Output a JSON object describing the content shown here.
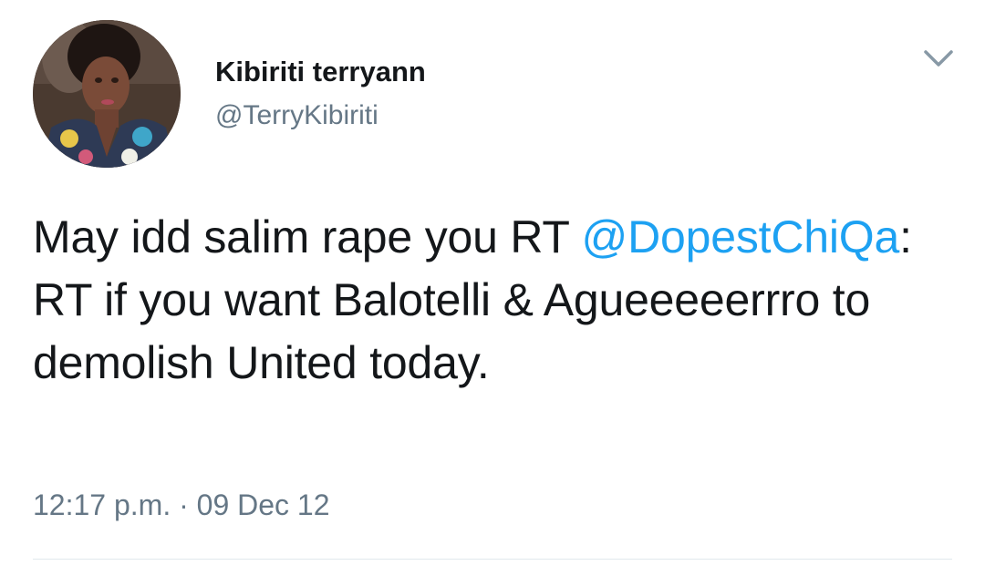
{
  "tweet": {
    "author": {
      "display_name": "Kibiriti terryann",
      "handle": "@TerryKibiriti",
      "avatar_icon": "profile-photo"
    },
    "menu_icon": "chevron-down-icon",
    "text": {
      "part1": "May idd salim rape you RT ",
      "mention": "@DopestChiQa",
      "part2": ": RT if you want Balotelli & Agueeeeerrro to demolish United today."
    },
    "timestamp": "12:17 p.m. · 09 Dec 12"
  },
  "colors": {
    "text": "#14171a",
    "secondary": "#657786",
    "link": "#1da1f2",
    "divider": "#e1e8ed"
  }
}
